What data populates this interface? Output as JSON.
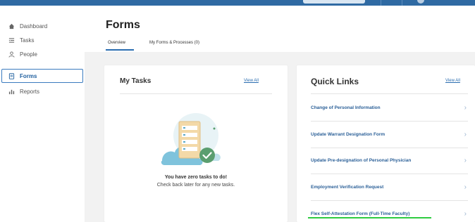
{
  "sidebar": {
    "items": [
      {
        "label": "Dashboard",
        "icon": "home-icon"
      },
      {
        "label": "Tasks",
        "icon": "tasks-icon"
      },
      {
        "label": "People",
        "icon": "people-icon"
      },
      {
        "label": "Forms",
        "icon": "forms-icon",
        "active": true
      },
      {
        "label": "Reports",
        "icon": "reports-icon"
      }
    ]
  },
  "header": {
    "title": "Forms",
    "tabs": [
      {
        "label": "Overview",
        "active": true
      },
      {
        "label": "My Forms & Processes (0)"
      }
    ]
  },
  "my_tasks": {
    "title": "My Tasks",
    "view_all": "View All",
    "empty_title": "You have zero tasks to do!",
    "empty_subtitle": "Check back later for any new tasks."
  },
  "quick_links": {
    "title": "Quick Links",
    "view_all": "View All",
    "items": [
      {
        "label": "Change of Personal Information"
      },
      {
        "label": "Update Warrant Designation Form"
      },
      {
        "label": "Update Pre-designation of Personal Physician"
      },
      {
        "label": "Employment Verification Request"
      },
      {
        "label": "Flex Self-Attestation Form (Full-Time Faculty)"
      }
    ]
  },
  "colors": {
    "topbar": "#2f6aa3",
    "accent": "#2a6db0",
    "link": "#2a5f97",
    "highlight": "#2ecc40",
    "main_bg": "#f2f2f2"
  }
}
